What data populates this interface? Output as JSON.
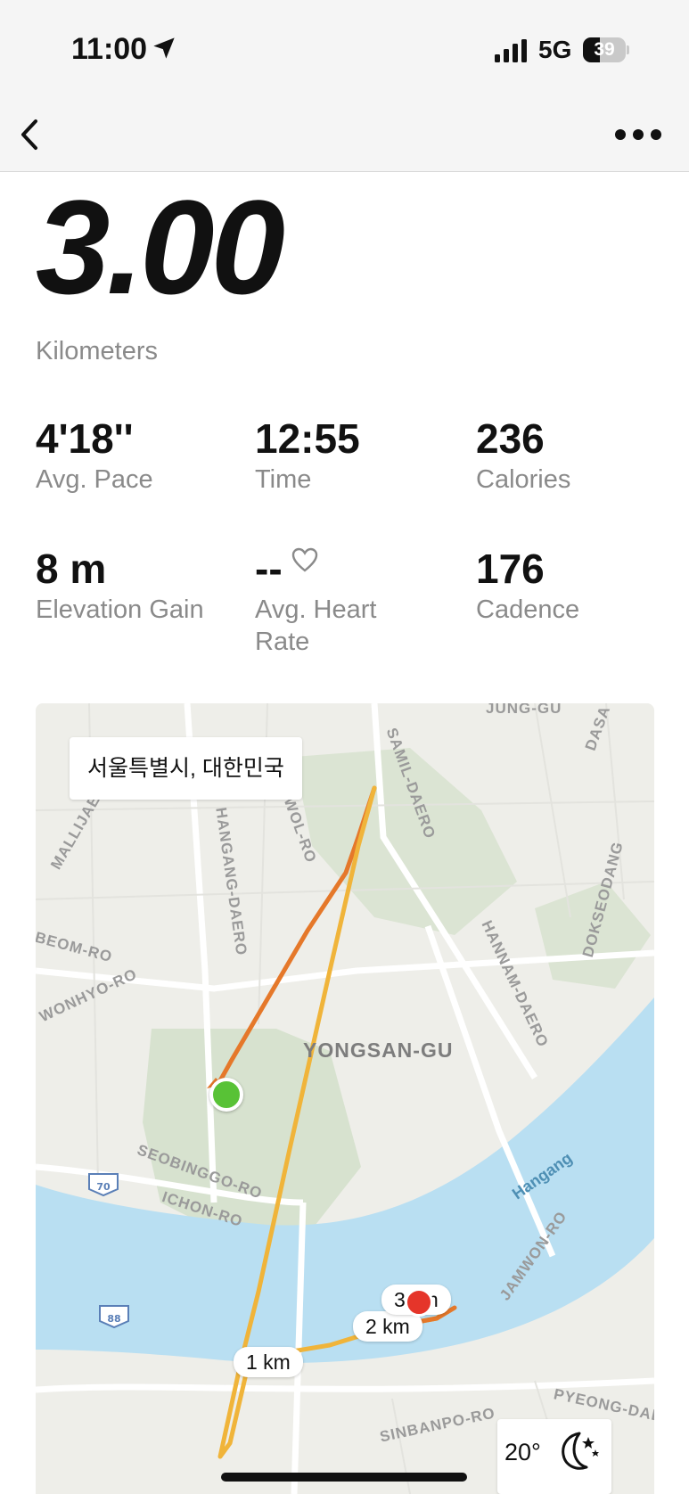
{
  "status_bar": {
    "time": "11:00",
    "network": "5G",
    "battery_level": "39",
    "battery_fraction": 0.39,
    "icons": [
      "location-arrow-icon",
      "cellular-signal-icon",
      "battery-icon"
    ]
  },
  "nav": {
    "back_icon": "chevron-left-icon",
    "more_icon": "ellipsis-icon"
  },
  "summary": {
    "distance": "3.00",
    "distance_unit": "Kilometers"
  },
  "stats": [
    {
      "value": "4'18''",
      "label": "Avg. Pace"
    },
    {
      "value": "12:55",
      "label": "Time"
    },
    {
      "value": "236",
      "label": "Calories"
    },
    {
      "value": "8 m",
      "label": "Elevation Gain"
    },
    {
      "value": "--",
      "label": "Avg. Heart Rate",
      "icon": "heart-outline-icon"
    },
    {
      "value": "176",
      "label": "Cadence"
    }
  ],
  "map": {
    "location": "서울특별시, 대한민국",
    "district": "YONGSAN-GU",
    "river": "Hangang",
    "streets": {
      "jung_gu": "JUNG-GU",
      "dasa": "DASA",
      "samil": "SAMIL-DAERO",
      "wonhyo": "WONHYO-RO",
      "wollijae": "MALLIJAE-RO",
      "hangang_daero": "HANGANG-DAERO",
      "sowol": "SOWOL-RO",
      "beom": "BEOM-RO",
      "hannam": "HANNAM-DAERO",
      "dokseodang": "DOKSEODANG",
      "seobinggo": "SEOBINGGO-RO",
      "ichon": "ICHON-RO",
      "jamwon": "JAMWON-RO",
      "sinbanpo": "SINBANPO-RO",
      "pyeong": "PYEONG-DAE",
      "road_70": "70",
      "road_88": "88"
    },
    "km_markers": [
      "1 km",
      "2 km",
      "3 km"
    ],
    "weather": {
      "temperature": "20°",
      "icon": "moon-stars-icon"
    },
    "colors": {
      "route_start": "#e5782a",
      "route_end": "#f0b43a",
      "start_marker": "#58c236",
      "end_marker": "#e5352a",
      "water": "#b9dff2",
      "park": "#d7e2cf"
    }
  }
}
